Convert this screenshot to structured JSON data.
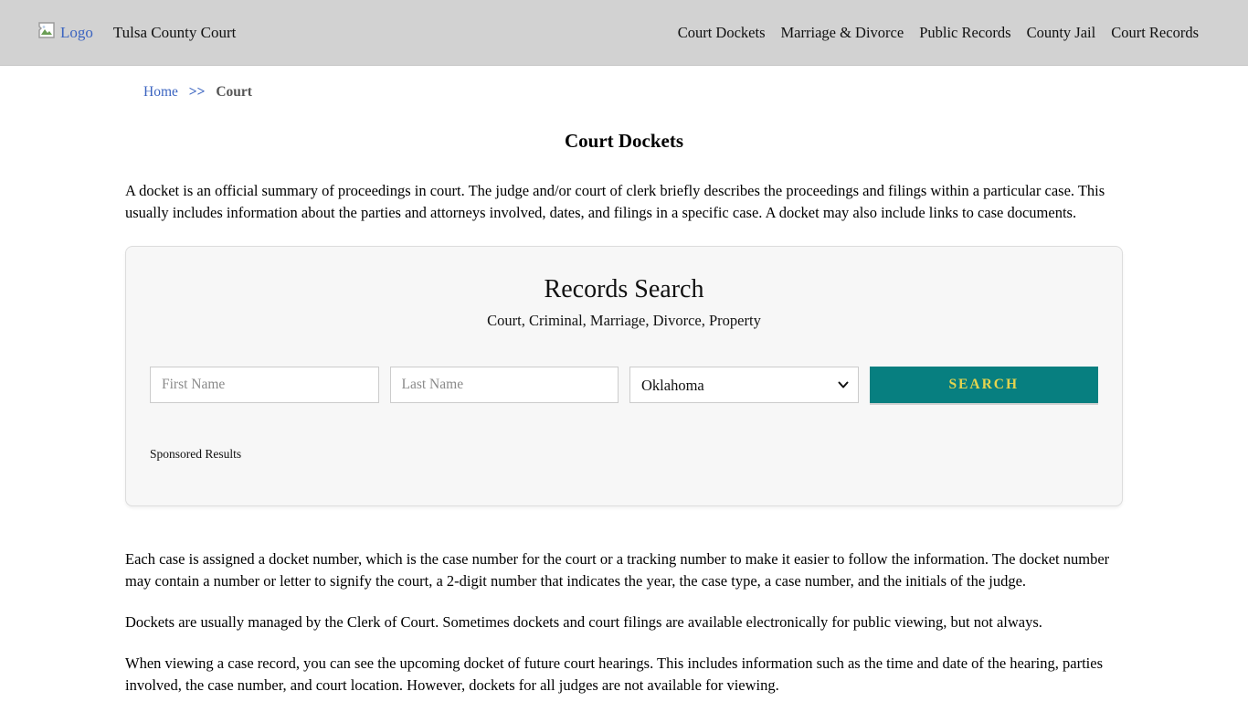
{
  "header": {
    "logo_alt": "Logo",
    "site_title": "Tulsa County Court",
    "nav": [
      {
        "label": "Court Dockets"
      },
      {
        "label": "Marriage & Divorce"
      },
      {
        "label": "Public Records"
      },
      {
        "label": "County Jail"
      },
      {
        "label": "Court Records"
      }
    ]
  },
  "breadcrumb": {
    "home": "Home",
    "separator": ">>",
    "current": "Court"
  },
  "page": {
    "title": "Court Dockets",
    "intro": "A docket is an official summary of proceedings in court. The judge and/or court of clerk briefly describes the proceedings and filings within a particular case. This usually includes information about the parties and attorneys involved, dates, and filings in a specific case. A docket may also include links to case documents.",
    "paragraphs": [
      "Each case is assigned a docket number, which is the case number for the court or a tracking number to make it easier to follow the information. The docket number may contain a number or letter to signify the court, a 2-digit number that indicates the year, the case type, a case number, and the initials of the judge.",
      "Dockets are usually managed by the Clerk of Court. Sometimes dockets and court filings are available electronically for public viewing, but not always.",
      "When viewing a case record, you can see the upcoming docket of future court hearings. This includes information such as the time and date of the hearing, parties involved, the case number, and court location. However, dockets for all judges are not available for viewing."
    ]
  },
  "search": {
    "title": "Records Search",
    "subtitle": "Court, Criminal, Marriage, Divorce, Property",
    "first_name_placeholder": "First Name",
    "last_name_placeholder": "Last Name",
    "state_selected": "Oklahoma",
    "button_label": "SEARCH",
    "sponsored_label": "Sponsored Results"
  },
  "colors": {
    "header_bg": "#d2d2d2",
    "panel_bg": "#f7f7f7",
    "button_bg": "#077f80",
    "button_text": "#e5d44e",
    "link_blue": "#3b64c0"
  }
}
